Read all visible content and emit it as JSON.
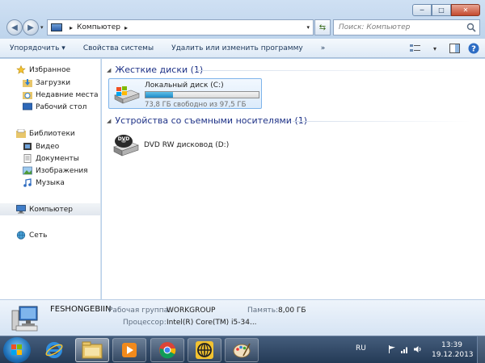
{
  "window": {
    "minimize": "─",
    "maximize": "□",
    "close": "✕"
  },
  "address_bar": {
    "crumbs": [
      "Компьютер"
    ],
    "search_placeholder": "Поиск: Компьютер"
  },
  "toolbar": {
    "items": [
      "Упорядочить ▾",
      "Свойства системы",
      "Удалить или изменить программу",
      "»"
    ]
  },
  "nav_pane": {
    "favorites": {
      "label": "Избранное",
      "items": [
        "Загрузки",
        "Недавние места",
        "Рабочий стол"
      ]
    },
    "libraries": {
      "label": "Библиотеки",
      "items": [
        "Видео",
        "Документы",
        "Изображения",
        "Музыка"
      ]
    },
    "computer": "Компьютер",
    "network": "Сеть"
  },
  "content": {
    "hard_drives_header": "Жесткие диски (1)",
    "local_disk": {
      "name": "Локальный диск (C:)",
      "free_text": "73,8 ГБ свободно из 97,5 ГБ",
      "used_fraction": 0.243
    },
    "removable_header": "Устройства со съемными носителями (1)",
    "dvd": {
      "name": "DVD RW дисковод (D:)",
      "icon_text": "DVD"
    }
  },
  "details": {
    "computer_name": "FESHONGEBIIN",
    "workgroup_label": "Рабочая группа:",
    "workgroup_value": "WORKGROUP",
    "memory_label": "Память:",
    "memory_value": "8,00 ГБ",
    "processor_label": "Процессор:",
    "processor_value": "Intel(R) Core(TM) i5-34..."
  },
  "taskbar": {
    "lang": "RU",
    "time": "13:39",
    "date": "19.12.2013"
  },
  "colors": {
    "accent": "#1e3287",
    "progress": "#1e89c7",
    "taskbar": "#2b4160"
  }
}
